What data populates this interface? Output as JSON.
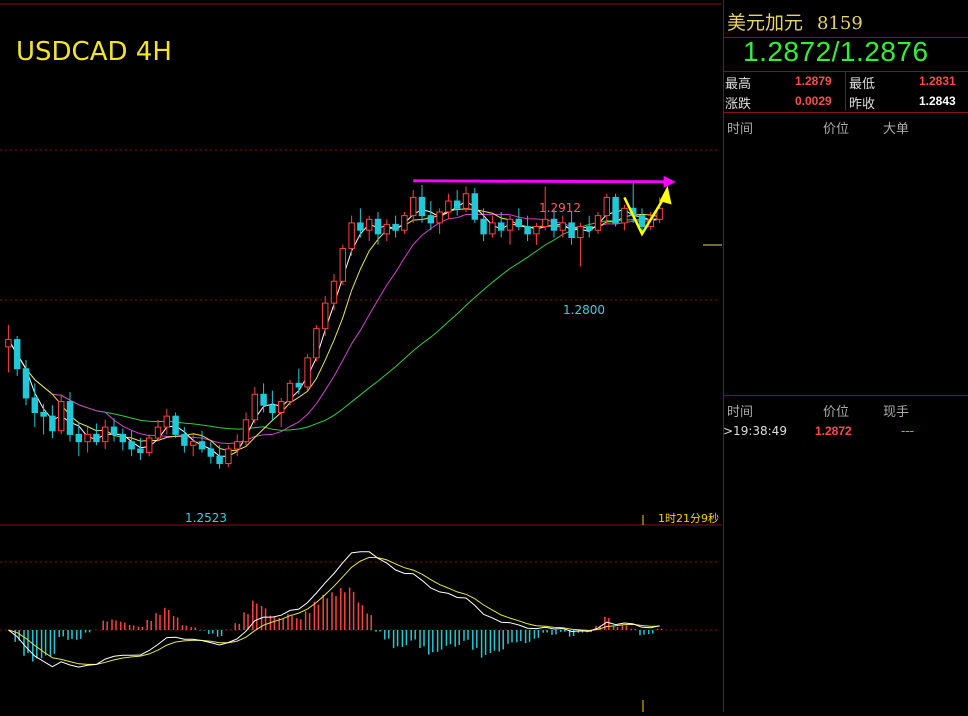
{
  "chart_data": [
    {
      "type": "candlestick",
      "title": "USDCAD 4H",
      "ylim": [
        1.248,
        1.296
      ],
      "price_labels": {
        "high": "1.2912",
        "low": "1.2523",
        "range_low": "1.2800"
      },
      "countdown": "1时21分9秒",
      "candles": [
        [
          1.269,
          1.272,
          1.2655,
          1.27
        ],
        [
          1.27,
          1.2705,
          1.265,
          1.266
        ],
        [
          1.266,
          1.2672,
          1.261,
          1.262
        ],
        [
          1.262,
          1.264,
          1.258,
          1.26
        ],
        [
          1.26,
          1.2612,
          1.257,
          1.2595
        ],
        [
          1.2595,
          1.261,
          1.2565,
          1.2575
        ],
        [
          1.2575,
          1.2625,
          1.257,
          1.2615
        ],
        [
          1.2615,
          1.2628,
          1.256,
          1.257
        ],
        [
          1.257,
          1.2585,
          1.254,
          1.256
        ],
        [
          1.256,
          1.258,
          1.2545,
          1.257
        ],
        [
          1.257,
          1.2585,
          1.2555,
          1.256
        ],
        [
          1.256,
          1.259,
          1.255,
          1.258
        ],
        [
          1.258,
          1.2592,
          1.256,
          1.257
        ],
        [
          1.257,
          1.2578,
          1.2548,
          1.256
        ],
        [
          1.256,
          1.2575,
          1.254,
          1.255
        ],
        [
          1.255,
          1.2565,
          1.2535,
          1.2545
        ],
        [
          1.2545,
          1.257,
          1.254,
          1.2565
        ],
        [
          1.2565,
          1.259,
          1.256,
          1.258
        ],
        [
          1.258,
          1.2605,
          1.257,
          1.2595
        ],
        [
          1.2595,
          1.26,
          1.2565,
          1.257
        ],
        [
          1.257,
          1.258,
          1.2545,
          1.2555
        ],
        [
          1.2555,
          1.257,
          1.254,
          1.256
        ],
        [
          1.256,
          1.2575,
          1.2545,
          1.255
        ],
        [
          1.255,
          1.256,
          1.253,
          1.254
        ],
        [
          1.254,
          1.2555,
          1.2523,
          1.253
        ],
        [
          1.253,
          1.2555,
          1.2525,
          1.255
        ],
        [
          1.255,
          1.257,
          1.254,
          1.256
        ],
        [
          1.256,
          1.26,
          1.2555,
          1.259
        ],
        [
          1.259,
          1.2635,
          1.2585,
          1.2625
        ],
        [
          1.2625,
          1.264,
          1.26,
          1.261
        ],
        [
          1.261,
          1.263,
          1.259,
          1.26
        ],
        [
          1.26,
          1.262,
          1.258,
          1.2615
        ],
        [
          1.2615,
          1.2645,
          1.261,
          1.264
        ],
        [
          1.264,
          1.266,
          1.2625,
          1.2635
        ],
        [
          1.2635,
          1.268,
          1.263,
          1.2675
        ],
        [
          1.2675,
          1.272,
          1.267,
          1.2715
        ],
        [
          1.2715,
          1.276,
          1.2705,
          1.275
        ],
        [
          1.275,
          1.279,
          1.274,
          1.278
        ],
        [
          1.278,
          1.283,
          1.2775,
          1.2825
        ],
        [
          1.2825,
          1.287,
          1.2815,
          1.286
        ],
        [
          1.286,
          1.288,
          1.284,
          1.285
        ],
        [
          1.285,
          1.287,
          1.2835,
          1.2865
        ],
        [
          1.2865,
          1.2875,
          1.283,
          1.2845
        ],
        [
          1.2845,
          1.2865,
          1.2835,
          1.2858
        ],
        [
          1.2858,
          1.287,
          1.284,
          1.285
        ],
        [
          1.285,
          1.2875,
          1.2845,
          1.287
        ],
        [
          1.287,
          1.2905,
          1.286,
          1.2895
        ],
        [
          1.2895,
          1.2912,
          1.286,
          1.287
        ],
        [
          1.287,
          1.289,
          1.285,
          1.286
        ],
        [
          1.286,
          1.288,
          1.2845,
          1.2875
        ],
        [
          1.2875,
          1.29,
          1.2865,
          1.289
        ],
        [
          1.289,
          1.2905,
          1.287,
          1.288
        ],
        [
          1.288,
          1.291,
          1.2875,
          1.29
        ],
        [
          1.29,
          1.2908,
          1.286,
          1.2865
        ],
        [
          1.2865,
          1.288,
          1.2835,
          1.2845
        ],
        [
          1.2845,
          1.287,
          1.284,
          1.286
        ],
        [
          1.286,
          1.2875,
          1.284,
          1.285
        ],
        [
          1.285,
          1.287,
          1.283,
          1.2865
        ],
        [
          1.2865,
          1.288,
          1.285,
          1.2855
        ],
        [
          1.2855,
          1.287,
          1.2835,
          1.2845
        ],
        [
          1.2845,
          1.286,
          1.283,
          1.2855
        ],
        [
          1.2855,
          1.291,
          1.285,
          1.2865
        ],
        [
          1.2865,
          1.288,
          1.284,
          1.285
        ],
        [
          1.285,
          1.287,
          1.284,
          1.286
        ],
        [
          1.286,
          1.2875,
          1.283,
          1.284
        ],
        [
          1.284,
          1.286,
          1.28,
          1.2855
        ],
        [
          1.2855,
          1.287,
          1.284,
          1.285
        ],
        [
          1.285,
          1.2875,
          1.2845,
          1.287
        ],
        [
          1.287,
          1.29,
          1.286,
          1.2895
        ],
        [
          1.2895,
          1.29,
          1.2855,
          1.286
        ],
        [
          1.286,
          1.2885,
          1.285,
          1.288
        ],
        [
          1.288,
          1.2915,
          1.286,
          1.287
        ],
        [
          1.287,
          1.288,
          1.2845,
          1.2855
        ],
        [
          1.2855,
          1.2875,
          1.285,
          1.2865
        ],
        [
          1.2865,
          1.2895,
          1.286,
          1.288
        ]
      ],
      "ma_colors": {
        "ma_fast": "#ffffff",
        "ma_mid": "#e6e64a",
        "ma_slow": "#d040d0",
        "ma_long": "#2ecc40"
      },
      "annotation_colors": {
        "resistance_arrow": "#ff00ff",
        "projection_arrow": "#ffff00"
      }
    },
    {
      "type": "macd",
      "histogram_colors": {
        "positive": "#ff4040",
        "negative": "#20c8d8"
      },
      "line_colors": {
        "macd": "#ffffff",
        "signal": "#e6e64a"
      }
    }
  ],
  "quote": {
    "name": "美元加元",
    "code": "8159",
    "bid_ask": "1.2872/1.2876",
    "high_label": "最高",
    "high": "1.2879",
    "low_label": "最低",
    "low": "1.2831",
    "change_label": "涨跌",
    "change": "0.0029",
    "prev_close_label": "昨收",
    "prev_close": "1.2843"
  },
  "big_orders": {
    "headers": [
      "时间",
      "价位",
      "大单"
    ]
  },
  "ticks": {
    "headers": [
      "时间",
      "价位",
      "现手"
    ],
    "rows": [
      {
        "time": ">19:38:49",
        "price": "1.2872",
        "volume": "---"
      }
    ]
  }
}
